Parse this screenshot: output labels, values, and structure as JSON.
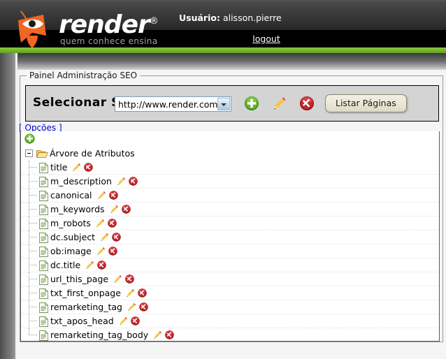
{
  "header": {
    "logo_word": "render",
    "logo_registered": "®",
    "logo_tagline": "quem conhece ensina",
    "user_label": "Usuário:",
    "user_name": "alisson.pierre",
    "logout_label": "logout",
    "accent_green": "#7ab32e",
    "background": "#000000"
  },
  "panel": {
    "legend": "Painel Administração SEO"
  },
  "toolbar": {
    "select_site_label": "Selecionar Site",
    "site_select": {
      "value": "http://www.render.com.br",
      "options": [
        "http://www.render.com.br"
      ]
    },
    "add_label": "add-site",
    "edit_label": "edit-site",
    "delete_label": "delete-site",
    "listar_paginas_label": "Listar Páginas"
  },
  "options_link": "[ Opções ]",
  "tree": {
    "add_node_label": "add-node",
    "root": {
      "label": "Árvore de Atributos",
      "expanded": true
    },
    "items": [
      {
        "label": "title"
      },
      {
        "label": "m_description"
      },
      {
        "label": "canonical"
      },
      {
        "label": "m_keywords"
      },
      {
        "label": "m_robots"
      },
      {
        "label": "dc.subject"
      },
      {
        "label": "ob:image"
      },
      {
        "label": "dc.title"
      },
      {
        "label": "url_this_page"
      },
      {
        "label": "txt_first_onpage"
      },
      {
        "label": "remarketing_tag"
      },
      {
        "label": "txt_apos_head"
      },
      {
        "label": "remarketing_tag_body"
      }
    ]
  },
  "colors": {
    "add_green": "#4a9b1f",
    "delete_red": "#c4282b",
    "edit_yellow": "#e8b424",
    "link_blue": "#0000cc",
    "toolbar_gray": "#d4d4d4",
    "page_bg": "#f5f5f5"
  }
}
